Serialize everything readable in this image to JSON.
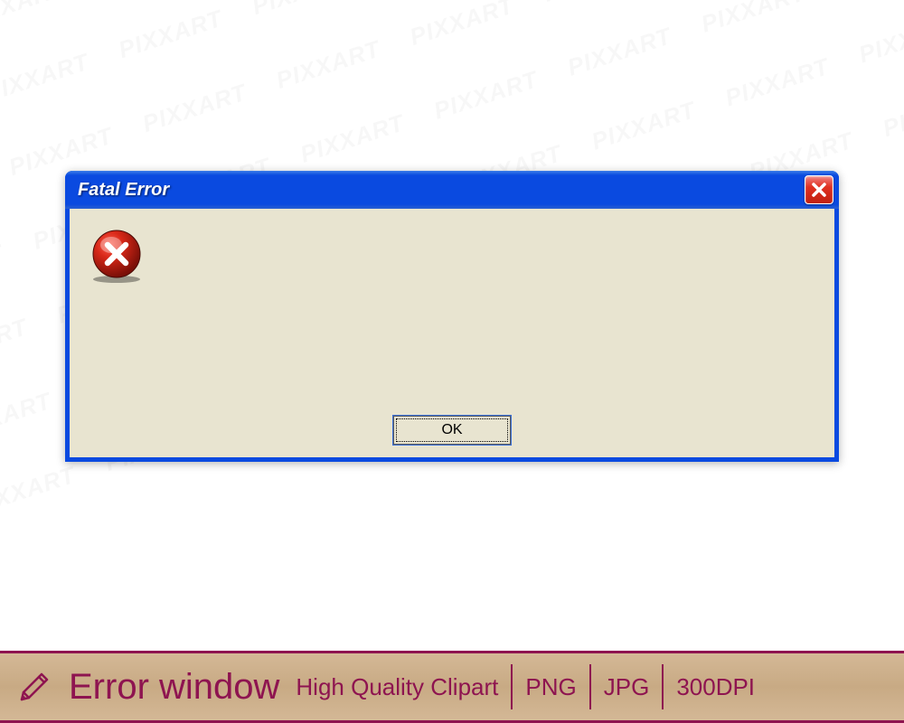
{
  "dialog": {
    "title": "Fatal Error",
    "ok_label": "OK"
  },
  "footer": {
    "title": "Error window",
    "subtitle": "High Quality Clipart",
    "format1": "PNG",
    "format2": "JPG",
    "dpi": "300DPI"
  },
  "watermark": "PIXXART",
  "colors": {
    "titlebar": "#0a4ae0",
    "body": "#e8e4d0",
    "close_button": "#e03020",
    "footer_accent": "#8e1450",
    "footer_bg": "#d4b896"
  }
}
